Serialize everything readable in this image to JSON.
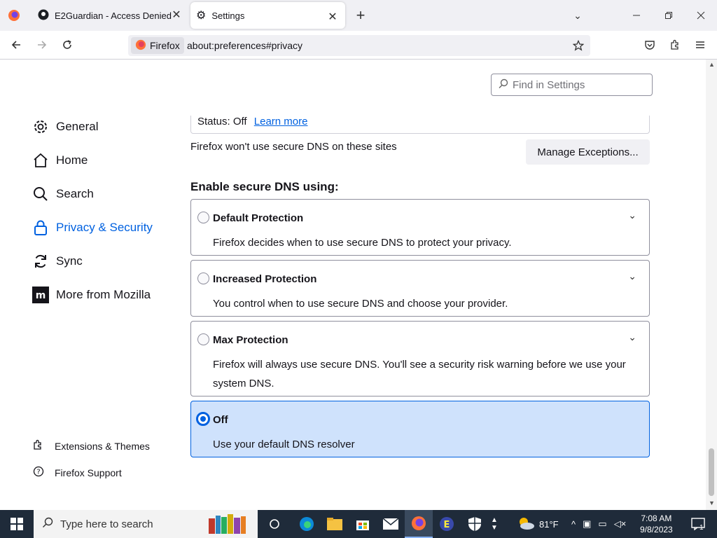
{
  "browser": {
    "tabs": [
      {
        "title": "E2Guardian - Access Denied",
        "close": "✕"
      },
      {
        "title": "Settings",
        "close": "✕"
      }
    ],
    "new_tab_label": "+",
    "identity_label": "Firefox",
    "url": "about:preferences#privacy"
  },
  "settings": {
    "find_placeholder": "Find in Settings",
    "nav": [
      {
        "label": "General",
        "icon": "gear-icon"
      },
      {
        "label": "Home",
        "icon": "home-icon"
      },
      {
        "label": "Search",
        "icon": "search-icon"
      },
      {
        "label": "Privacy & Security",
        "icon": "lock-icon"
      },
      {
        "label": "Sync",
        "icon": "sync-icon"
      },
      {
        "label": "More from Mozilla",
        "icon": "mozilla-icon"
      }
    ],
    "footer": [
      {
        "label": "Extensions & Themes",
        "icon": "puzzle-icon"
      },
      {
        "label": "Firefox Support",
        "icon": "help-icon"
      }
    ],
    "status_text": "Status: Off",
    "learn_more": "Learn more",
    "exceptions_note": "Firefox won't use secure DNS on these sites",
    "manage_exceptions": "Manage Exceptions...",
    "enable_heading": "Enable secure DNS using:",
    "options": [
      {
        "title": "Default Protection",
        "desc": "Firefox decides when to use secure DNS to protect your privacy."
      },
      {
        "title": "Increased Protection",
        "desc": "You control when to use secure DNS and choose your provider."
      },
      {
        "title": "Max Protection",
        "desc": "Firefox will always use secure DNS. You'll see a security risk warning before we use your system DNS."
      },
      {
        "title": "Off",
        "desc": "Use your default DNS resolver"
      }
    ],
    "selected_option": "Off"
  },
  "taskbar": {
    "search_placeholder": "Type here to search",
    "temperature": "81°F",
    "time": "7:08 AM",
    "date": "9/8/2023",
    "notification_count": "1"
  },
  "colors": {
    "accent": "#0061e0",
    "selected_bg": "#cfe2fc",
    "taskbar": "#1f2b3a"
  }
}
